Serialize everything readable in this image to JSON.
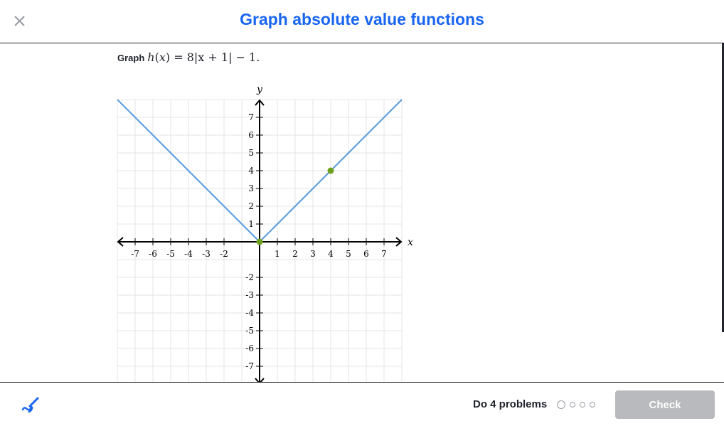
{
  "header": {
    "title": "Graph absolute value functions",
    "close_icon": "close-icon"
  },
  "question": {
    "prefix": "Graph",
    "function_lhs": "h",
    "function_arg": "x",
    "expression": "8|x + 1| − 1."
  },
  "graph": {
    "x_axis_label": "x",
    "y_axis_label": "y",
    "x_range": [
      -8,
      8
    ],
    "y_range": [
      -8,
      8
    ],
    "x_tick_labels": [
      "-7",
      "-6",
      "-5",
      "-4",
      "-3",
      "-2",
      "1",
      "2",
      "3",
      "4",
      "5",
      "6",
      "7"
    ],
    "y_tick_labels": [
      "7",
      "6",
      "5",
      "4",
      "3",
      "2",
      "1",
      "-2",
      "-3",
      "-4",
      "-5",
      "-6",
      "-7"
    ],
    "line_color": "#5a9be0",
    "point_color": "#6fa020",
    "points": [
      {
        "x": 0,
        "y": 0
      },
      {
        "x": 4,
        "y": 4
      }
    ],
    "grid": true
  },
  "footer": {
    "scratchpad_icon": "pencil-scratchpad-icon",
    "problems_label": "Do 4 problems",
    "progress_total": 4,
    "progress_done": 0,
    "check_label": "Check",
    "check_enabled": false
  },
  "colors": {
    "accent": "#1865f2",
    "text": "#21242c",
    "disabled": "#b9babd"
  }
}
